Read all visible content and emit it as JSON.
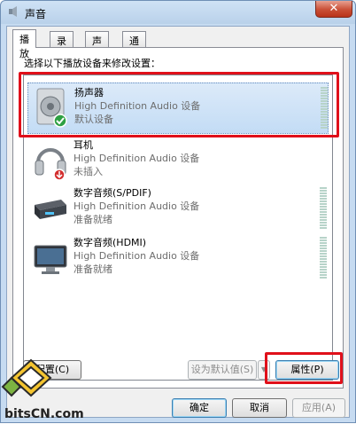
{
  "window": {
    "title": "声音",
    "close_glyph": "✕"
  },
  "tabs": [
    {
      "label": "播放",
      "active": true
    },
    {
      "label": "录制",
      "active": false
    },
    {
      "label": "声音",
      "active": false
    },
    {
      "label": "通信",
      "active": false
    }
  ],
  "instruction": "选择以下播放设备来修改设置：",
  "devices": [
    {
      "name": "扬声器",
      "description": "High Definition Audio 设备",
      "state": "默认设备",
      "icon": "speaker-icon",
      "selected": true
    },
    {
      "name": "耳机",
      "description": "High Definition Audio 设备",
      "state": "未插入",
      "icon": "headphones-icon",
      "selected": false
    },
    {
      "name": "数字音频(S/PDIF)",
      "description": "High Definition Audio 设备",
      "state": "准备就绪",
      "icon": "spdif-device-icon",
      "selected": false
    },
    {
      "name": "数字音频(HDMI)",
      "description": "High Definition Audio 设备",
      "state": "准备就绪",
      "icon": "monitor-icon",
      "selected": false
    }
  ],
  "buttons": {
    "configure": "配置(C)",
    "set_default": "设为默认值(S)",
    "properties": "属性(P)",
    "ok": "确定",
    "cancel": "取消",
    "apply": "应用(A)"
  },
  "watermark": {
    "text": "bitsCN.com"
  },
  "colors": {
    "highlight": "#e0101a",
    "selection": "#c3dcf5",
    "close_button": "#c94f36"
  }
}
